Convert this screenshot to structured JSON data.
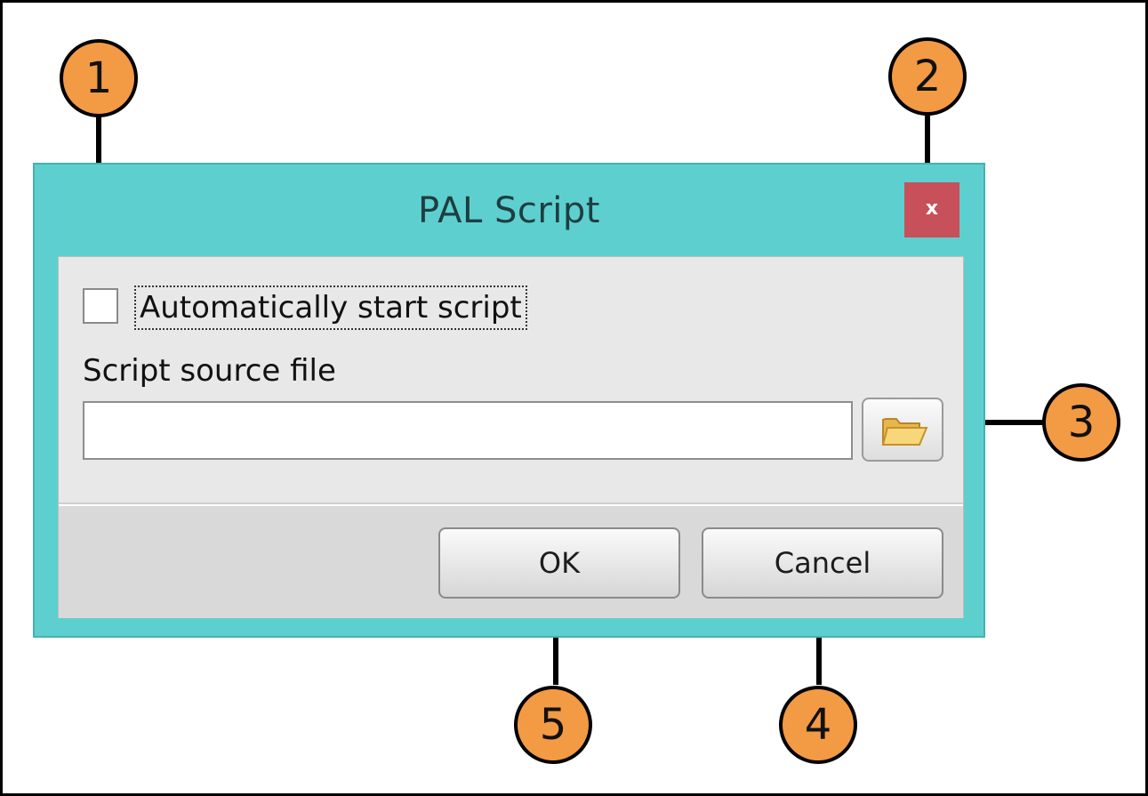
{
  "window": {
    "title": "PAL Script",
    "close_label": "x"
  },
  "form": {
    "auto_start_label": "Automatically start script",
    "auto_start_checked": false,
    "source_label": "Script source file",
    "source_value": "",
    "browse_icon": "folder-open-icon"
  },
  "buttons": {
    "ok_label": "OK",
    "cancel_label": "Cancel"
  },
  "callouts": [
    "1",
    "2",
    "3",
    "4",
    "5"
  ],
  "colors": {
    "titlebar": "#5ecfcf",
    "close_button": "#c7505a",
    "callout_fill": "#f39a44"
  }
}
